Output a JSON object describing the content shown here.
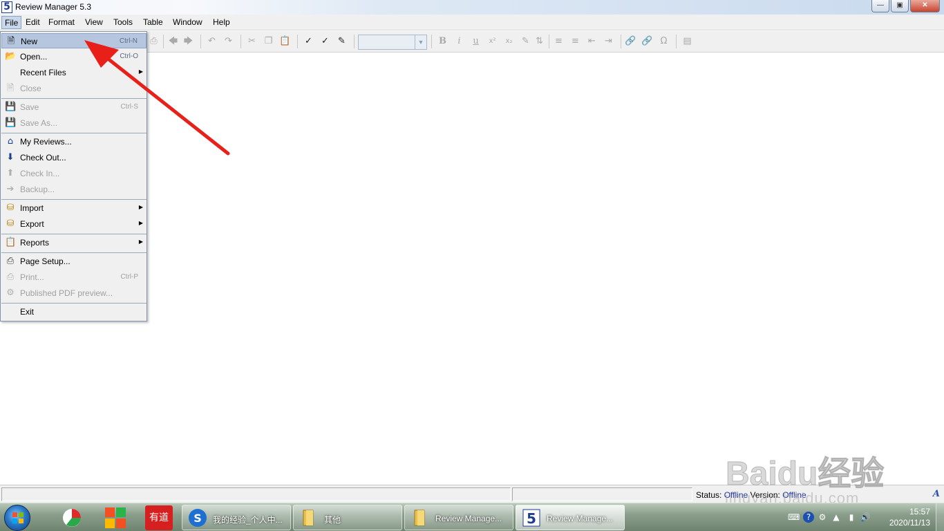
{
  "window": {
    "title": "Review Manager 5.3",
    "app_icon_glyph": "5",
    "controls": [
      "minimize",
      "maximize",
      "close"
    ]
  },
  "menubar": {
    "items": [
      "File",
      "Edit",
      "Format",
      "View",
      "Tools",
      "Table",
      "Window",
      "Help"
    ],
    "active": "File"
  },
  "file_menu": {
    "items": [
      {
        "label": "New",
        "shortcut": "Ctrl-N",
        "icon": "new-document-icon",
        "enabled": true,
        "highlighted": true
      },
      {
        "label": "Open...",
        "shortcut": "Ctrl-O",
        "icon": "open-folder-icon",
        "enabled": true
      },
      {
        "label": "Recent Files",
        "submenu": true,
        "enabled": true
      },
      {
        "label": "Close",
        "icon": "close-document-icon",
        "enabled": false
      },
      {
        "label": "Save",
        "shortcut": "Ctrl-S",
        "icon": "save-icon",
        "enabled": false
      },
      {
        "label": "Save As...",
        "icon": "save-as-icon",
        "enabled": false
      },
      {
        "label": "My Reviews...",
        "icon": "my-reviews-icon",
        "enabled": true
      },
      {
        "label": "Check Out...",
        "icon": "check-out-icon",
        "enabled": true
      },
      {
        "label": "Check In...",
        "icon": "check-in-icon",
        "enabled": false
      },
      {
        "label": "Backup...",
        "icon": "backup-icon",
        "enabled": false
      },
      {
        "label": "Import",
        "submenu": true,
        "icon": "import-icon",
        "enabled": true
      },
      {
        "label": "Export",
        "submenu": true,
        "icon": "export-icon",
        "enabled": true
      },
      {
        "label": "Reports",
        "submenu": true,
        "icon": "reports-icon",
        "enabled": true
      },
      {
        "label": "Page Setup...",
        "icon": "page-setup-icon",
        "enabled": true
      },
      {
        "label": "Print...",
        "shortcut": "Ctrl-P",
        "icon": "print-icon",
        "enabled": false
      },
      {
        "label": "Published PDF preview...",
        "icon": "pdf-preview-icon",
        "enabled": false
      },
      {
        "label": "Exit",
        "enabled": true
      }
    ]
  },
  "statusbar": {
    "status_label": "Status:",
    "status_value": "Offline",
    "version_label": "Version:",
    "version_value": "Offline"
  },
  "taskbar": {
    "buttons": [
      {
        "label": "我的经验_个人中...",
        "icon": "sogou-browser-icon"
      },
      {
        "label": "其他",
        "icon": "folder-icon"
      },
      {
        "label": "Review Manage...",
        "icon": "folder-icon"
      },
      {
        "label": "Review Manage...",
        "icon": "revman-icon",
        "active": true
      }
    ],
    "pinned": [
      "pie-chart-app-icon",
      "tiles-app-icon",
      "youdao-icon"
    ],
    "pinned_text": {
      "youdao": "有道"
    },
    "clock": {
      "time": "15:57",
      "date": "2020/11/13"
    }
  },
  "watermark": {
    "logo": "Baidu经验",
    "url": "jingyan.baidu.com"
  },
  "colors": {
    "annotation_arrow": "#e8201a",
    "menu_highlight": "#b5c6de",
    "status_value": "#1a2f99"
  }
}
